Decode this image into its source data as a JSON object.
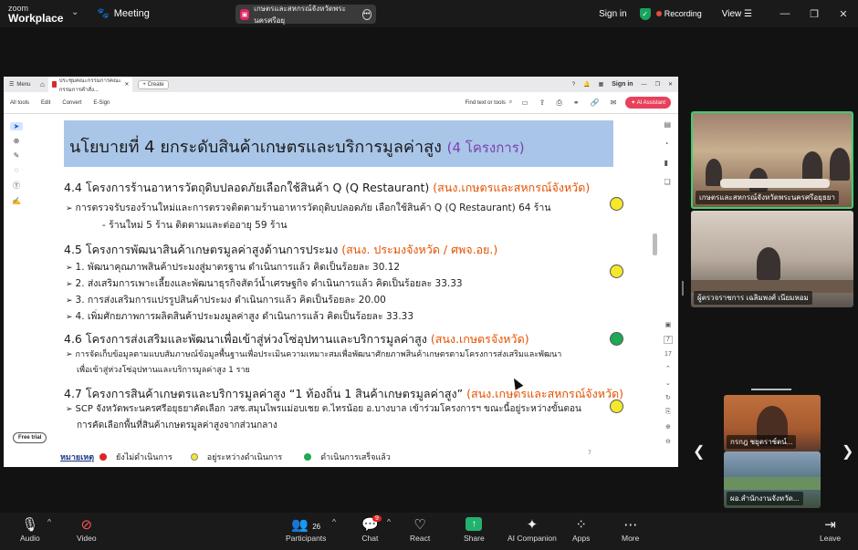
{
  "topbar": {
    "brand_small": "zoom",
    "brand": "Workplace",
    "meeting": "Meeting",
    "share_title": "เกษตรและสหกรณ์จังหวัดพระนครศรีอยุ",
    "signin": "Sign in",
    "recording": "Recording",
    "view": "View"
  },
  "browser": {
    "menu": "Menu",
    "tab_title": "ประชุมคณะกรรมการคณะกรรมการคำสั่ง...",
    "create": "Create",
    "signin": "Sign in",
    "menus": [
      "All tools",
      "Edit",
      "Convert",
      "E-Sign"
    ],
    "find_placeholder": "Find text or tools",
    "ai_label": "AI Assistant",
    "free_trial": "Free trial",
    "zoom_level": "7",
    "page_count": "17"
  },
  "slide": {
    "title": "นโยบายที่ 4 ยกระดับสินค้าเกษตรและบริการมูลค่าสูง",
    "title_highlight": "(4 โครงการ)",
    "sections": [
      {
        "heading": "4.4 โครงการร้านอาหารวัตถุดิบปลอดภัยเลือกใช้สินค้า Q (Q Restaurant)",
        "org": "(สนง.เกษตรและสหกรณ์จังหวัด)",
        "status": "in-progress",
        "lines": [
          "การตรวจรับรองร้านใหม่และการตรวจติดตามร้านอาหารวัตถุดิบปลอดภัย เลือกใช้สินค้า Q (Q Restaurant)       64  ร้าน",
          "- ร้านใหม่ 5 ร้าน                              ติดตามและต่ออายุ    59  ร้าน"
        ]
      },
      {
        "heading": "4.5 โครงการพัฒนาสินค้าเกษตรมูลค่าสูงด้านการประมง",
        "org": "(สนง. ประมงจังหวัด / ศพจ.อย.)",
        "status": "in-progress",
        "lines": [
          "1. พัฒนาคุณภาพสินค้าประมงสู่มาตรฐาน                        ดำเนินการแล้ว คิดเป็นร้อยละ  30.12",
          "2. ส่งเสริมการเพาะเลี้ยงและพัฒนาธุรกิจสัตว์น้ำเศรษฐกิจ          ดำเนินการแล้ว คิดเป็นร้อยละ  33.33",
          "3. การส่งเสริมการแปรรูปสินค้าประมง                              ดำเนินการแล้ว คิดเป็นร้อยละ  20.00",
          "4. เพิ่มศักยภาพการผลิตสินค้าประมงมูลค่าสูง                        ดำเนินการแล้ว คิดเป็นร้อยละ  33.33"
        ]
      },
      {
        "heading": "4.6 โครงการส่งเสริมและพัฒนาเพื่อเข้าสู่ห่วงโซ่อุปทานและบริการมูลค่าสูง",
        "org": "(สนง.เกษตรจังหวัด)",
        "status": "done",
        "lines": [
          "การจัดเก็บข้อมูลตามแบบสัมภาษณ์ข้อมูลพื้นฐานเพื่อประเมินความเหมาะสมเพื่อพัฒนาศักยภาพสินค้าเกษตรตามโครงการส่งเสริมและพัฒนา",
          "เพื่อเข้าสู่ห่วงโซ่อุปทานและบริการมูลค่าสูง       1        ราย"
        ]
      },
      {
        "heading": "4.7 โครงการสินค้าเกษตรและบริการมูลค่าสูง “1 ท้องถิ่น 1 สินค้าเกษตรมูลค่าสูง”",
        "org": "(สนง.เกษตรและสหกรณ์จังหวัด)",
        "status": "in-progress",
        "lines": [
          "SCP จังหวัดพระนครศรีอยุธยาคัดเลือก วสช.สมุนไพรแม่อบเชย ต.ไทรน้อย อ.บางบาล เข้าร่วมโครงการฯ   ขณะนี้อยู่ระหว่างขั้นตอน",
          "การคัดเลือกพื้นที่สินค้าเกษตรมูลค่าสูงจากส่วนกลาง"
        ]
      }
    ],
    "legend": {
      "title": "หมายเหตุ",
      "not_started": "ยังไม่ดำเนินการ",
      "in_progress": "อยู่ระหว่างดำเนินการ",
      "done": "ดำเนินการเสร็จแล้ว"
    },
    "page_number": "7",
    "colors": {
      "title_bg": "#a9c6e8",
      "title_highlight": "#7e3fb0",
      "org": "#e65100",
      "yellow": "#f5e82a",
      "green": "#1fa855",
      "red": "#e02424"
    }
  },
  "videos": [
    {
      "label": "เกษตรและสหกรณ์จังหวัดพระนครศรีอยุธยา"
    },
    {
      "label": "ผู้ตรวจราชการ เฉลิมพงศ์ เนียมหอม"
    },
    {
      "label": "กรกฎ ชยุตราช์ตน์..."
    },
    {
      "label": "ผอ.สำนักงานจังหวัด..."
    }
  ],
  "controls": {
    "audio": "Audio",
    "video": "Video",
    "participants": "Participants",
    "participants_count": "26",
    "chat": "Chat",
    "chat_badge": "9",
    "react": "React",
    "share": "Share",
    "ai_companion": "AI Companion",
    "apps": "Apps",
    "more": "More",
    "leave": "Leave"
  }
}
